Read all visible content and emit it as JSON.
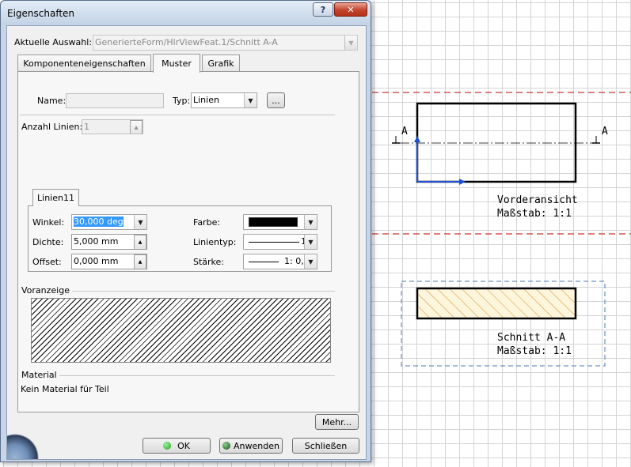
{
  "window": {
    "title": "Eigenschaften"
  },
  "selection": {
    "label": "Aktuelle Auswahl:",
    "value": "GenerierteForm/HlrViewFeat.1/Schnitt A-A"
  },
  "tabs": [
    {
      "label": "Komponenteneigenschaften",
      "active": false
    },
    {
      "label": "Muster",
      "active": true
    },
    {
      "label": "Grafik",
      "active": false
    }
  ],
  "muster": {
    "name_label": "Name:",
    "name_value": "",
    "typ_label": "Typ:",
    "typ_value": "Linien",
    "browse_label": "...",
    "anzahl_label": "Anzahl Linien:",
    "anzahl_value": "1",
    "inner_tab": "Linien11",
    "winkel_label": "Winkel:",
    "winkel_value": "30,000 deg",
    "dichte_label": "Dichte:",
    "dichte_value": "5,000 mm",
    "offset_label": "Offset:",
    "offset_value": "0,000 mm",
    "farbe_label": "Farbe:",
    "farbe_value": "#000000",
    "linientyp_label": "Linientyp:",
    "linientyp_value": "1",
    "staerke_label": "Stärke:",
    "staerke_value": "1: 0,",
    "voranzeige_label": "Voranzeige",
    "material_label": "Material",
    "material_value": "Kein Material für Teil"
  },
  "buttons": {
    "more": "Mehr...",
    "ok": "OK",
    "apply": "Anwenden",
    "close": "Schließen"
  },
  "drawing": {
    "front_view": {
      "title": "Vorderansicht",
      "scale": "Maßstab:  1:1"
    },
    "section_view": {
      "title": "Schnitt A-A",
      "scale": "Maßstab:  1:1"
    },
    "section_marker": "A"
  },
  "colors": {
    "dialog_frame": "#c7d5e6",
    "close_button": "#c4432b",
    "red_dashed": "#cc3333",
    "blue_dashed": "#4a7ab8",
    "axis_blue": "#1a4fd6",
    "hatch_orange": "#d98a2a",
    "section_fill": "#fdf6dc"
  },
  "icons": {
    "help": "question-mark-icon",
    "close": "close-x-icon",
    "dropdown": "chevron-down-icon",
    "ok_dot": "green-dot-icon",
    "apply_dot": "dark-green-dot-icon"
  }
}
